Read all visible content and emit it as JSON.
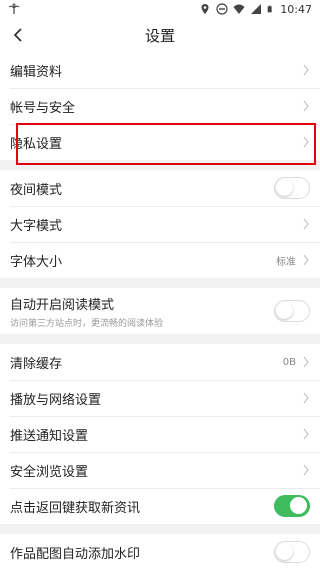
{
  "status_bar": {
    "time": "10:47"
  },
  "header": {
    "title": "设置"
  },
  "groups": [
    {
      "rows": [
        {
          "label": "编辑资料"
        },
        {
          "label": "帐号与安全"
        },
        {
          "label": "隐私设置"
        }
      ]
    },
    {
      "rows": [
        {
          "label": "夜间模式",
          "toggle": "off"
        },
        {
          "label": "大字模式"
        },
        {
          "label": "字体大小",
          "value": "标准"
        }
      ]
    },
    {
      "rows": [
        {
          "label": "自动开启阅读模式",
          "sub": "访问第三方站点时，更流畅的阅读体验",
          "toggle": "off"
        }
      ]
    },
    {
      "rows": [
        {
          "label": "清除缓存",
          "value": "0B"
        },
        {
          "label": "播放与网络设置"
        },
        {
          "label": "推送通知设置"
        },
        {
          "label": "安全浏览设置"
        },
        {
          "label": "点击返回键获取新资讯",
          "toggle": "on"
        }
      ]
    },
    {
      "rows": [
        {
          "label": "作品配图自动添加水印",
          "toggle": "off"
        }
      ]
    }
  ],
  "colors": {
    "toggle_on": "#3ebc5e",
    "highlight": "#e0000f"
  }
}
